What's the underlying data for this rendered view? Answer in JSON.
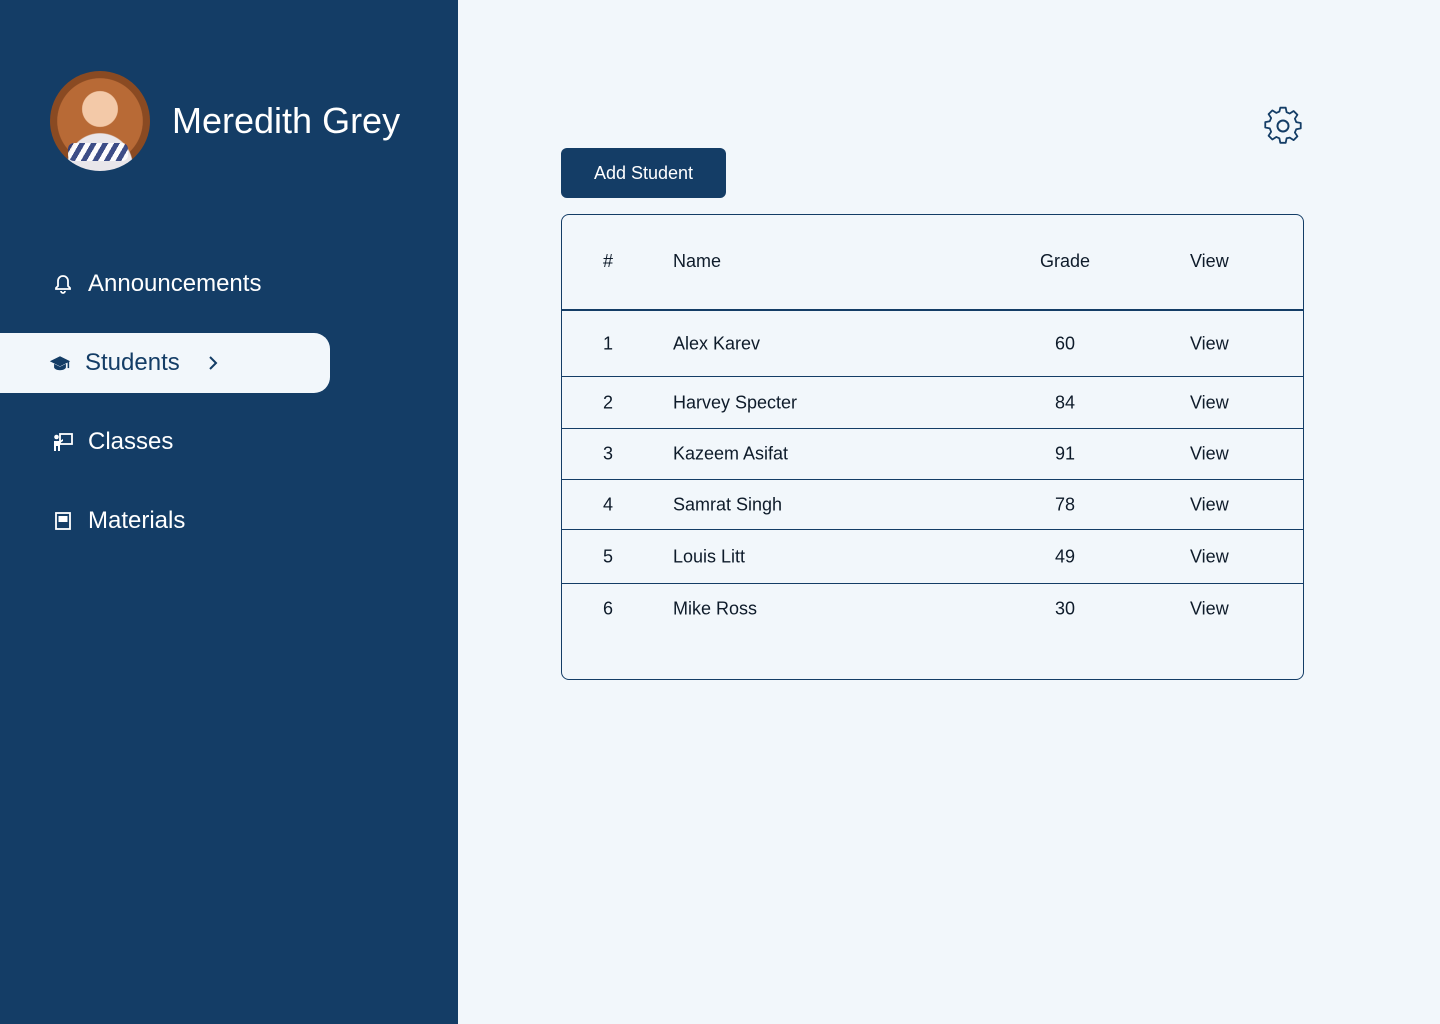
{
  "profile": {
    "name": "Meredith Grey",
    "avatar_alt": "Profile photo"
  },
  "nav": {
    "items": [
      {
        "label": "Announcements",
        "icon": "bell-icon"
      },
      {
        "label": "Students",
        "icon": "graduation-cap-icon",
        "active": true
      },
      {
        "label": "Classes",
        "icon": "teacher-board-icon"
      },
      {
        "label": "Materials",
        "icon": "book-icon"
      }
    ]
  },
  "toolbar": {
    "add_student_label": "Add Student",
    "settings_icon": "gear-icon"
  },
  "table": {
    "headers": {
      "num": "#",
      "name": "Name",
      "grade": "Grade",
      "view": "View"
    },
    "rows": [
      {
        "num": "1",
        "name": "Alex Karev",
        "grade": "60",
        "view": "View"
      },
      {
        "num": "2",
        "name": "Harvey Specter",
        "grade": "84",
        "view": "View"
      },
      {
        "num": "3",
        "name": "Kazeem Asifat",
        "grade": "91",
        "view": "View"
      },
      {
        "num": "4",
        "name": "Samrat Singh",
        "grade": "78",
        "view": "View"
      },
      {
        "num": "5",
        "name": "Louis Litt",
        "grade": "49",
        "view": "View"
      },
      {
        "num": "6",
        "name": "Mike Ross",
        "grade": "30",
        "view": "View"
      }
    ]
  },
  "colors": {
    "sidebar": "#143d66",
    "background": "#f2f7fb",
    "accent": "#143d66",
    "text": "#0e1b2a"
  }
}
